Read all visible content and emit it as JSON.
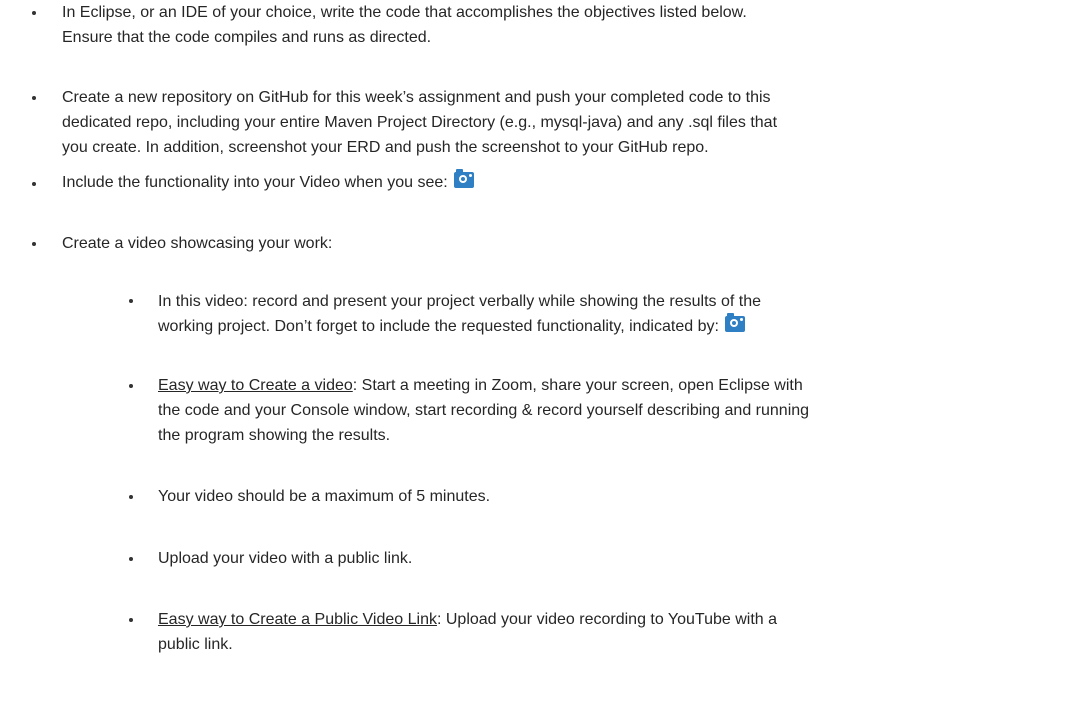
{
  "document": {
    "bullets": [
      {
        "lines": [
          "In Eclipse, or an IDE of your choice, write the code that accomplishes the objectives listed below.",
          "Ensure that the code compiles and runs as directed."
        ]
      },
      {
        "lines": [
          "Create a new repository on GitHub for this week’s assignment and push your completed code to this",
          "dedicated repo, including your entire Maven Project Directory (e.g., mysql-java) and any .sql files that",
          "you create.  In addition, screenshot your ERD and push the screenshot to your GitHub repo."
        ]
      },
      {
        "text": "Include the functionality into your Video when you see:",
        "icon": "camera-icon"
      },
      {
        "text": "Create a video showcasing your work:"
      }
    ],
    "sub_bullets": [
      {
        "lines": [
          "In this video: record and present your project verbally while showing the results of the",
          "working project.   Don’t forget to include the requested functionality, indicated by:"
        ],
        "icon": "camera-icon"
      },
      {
        "link_text": "Easy way to Create a video",
        "lines": [
          ":  Start a meeting in Zoom, share your screen, open Eclipse with",
          "the code and your Console window, start recording & record yourself describing and running",
          "the program showing the results."
        ]
      },
      {
        "text": "Your video should be a maximum of 5 minutes."
      },
      {
        "text": "Upload your video with a public link."
      },
      {
        "link_text": "Easy way to Create a Public Video Link",
        "lines": [
          ":  Upload your video recording to YouTube with a",
          "public link."
        ]
      }
    ]
  }
}
